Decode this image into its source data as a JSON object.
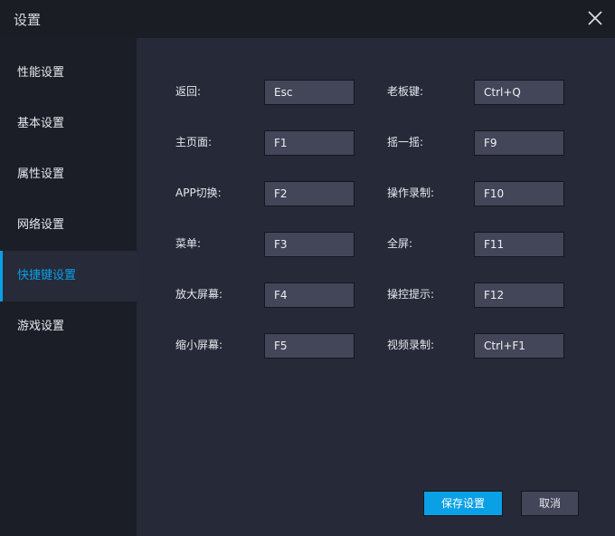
{
  "window": {
    "title": "设置"
  },
  "sidebar": {
    "items": [
      {
        "label": "性能设置",
        "active": false
      },
      {
        "label": "基本设置",
        "active": false
      },
      {
        "label": "属性设置",
        "active": false
      },
      {
        "label": "网络设置",
        "active": false
      },
      {
        "label": "快捷键设置",
        "active": true
      },
      {
        "label": "游戏设置",
        "active": false
      }
    ]
  },
  "shortcuts": {
    "left": [
      {
        "label": "返回:",
        "value": "Esc"
      },
      {
        "label": "主页面:",
        "value": "F1"
      },
      {
        "label": "APP切换:",
        "value": "F2"
      },
      {
        "label": "菜单:",
        "value": "F3"
      },
      {
        "label": "放大屏幕:",
        "value": "F4"
      },
      {
        "label": "缩小屏幕:",
        "value": "F5"
      }
    ],
    "right": [
      {
        "label": "老板键:",
        "value": "Ctrl+Q"
      },
      {
        "label": "摇一摇:",
        "value": "F9"
      },
      {
        "label": "操作录制:",
        "value": "F10"
      },
      {
        "label": "全屏:",
        "value": "F11"
      },
      {
        "label": "操控提示:",
        "value": "F12"
      },
      {
        "label": "视频录制:",
        "value": "Ctrl+F1"
      }
    ]
  },
  "buttons": {
    "save": "保存设置",
    "cancel": "取消"
  },
  "colors": {
    "accent": "#0aa0e6"
  }
}
